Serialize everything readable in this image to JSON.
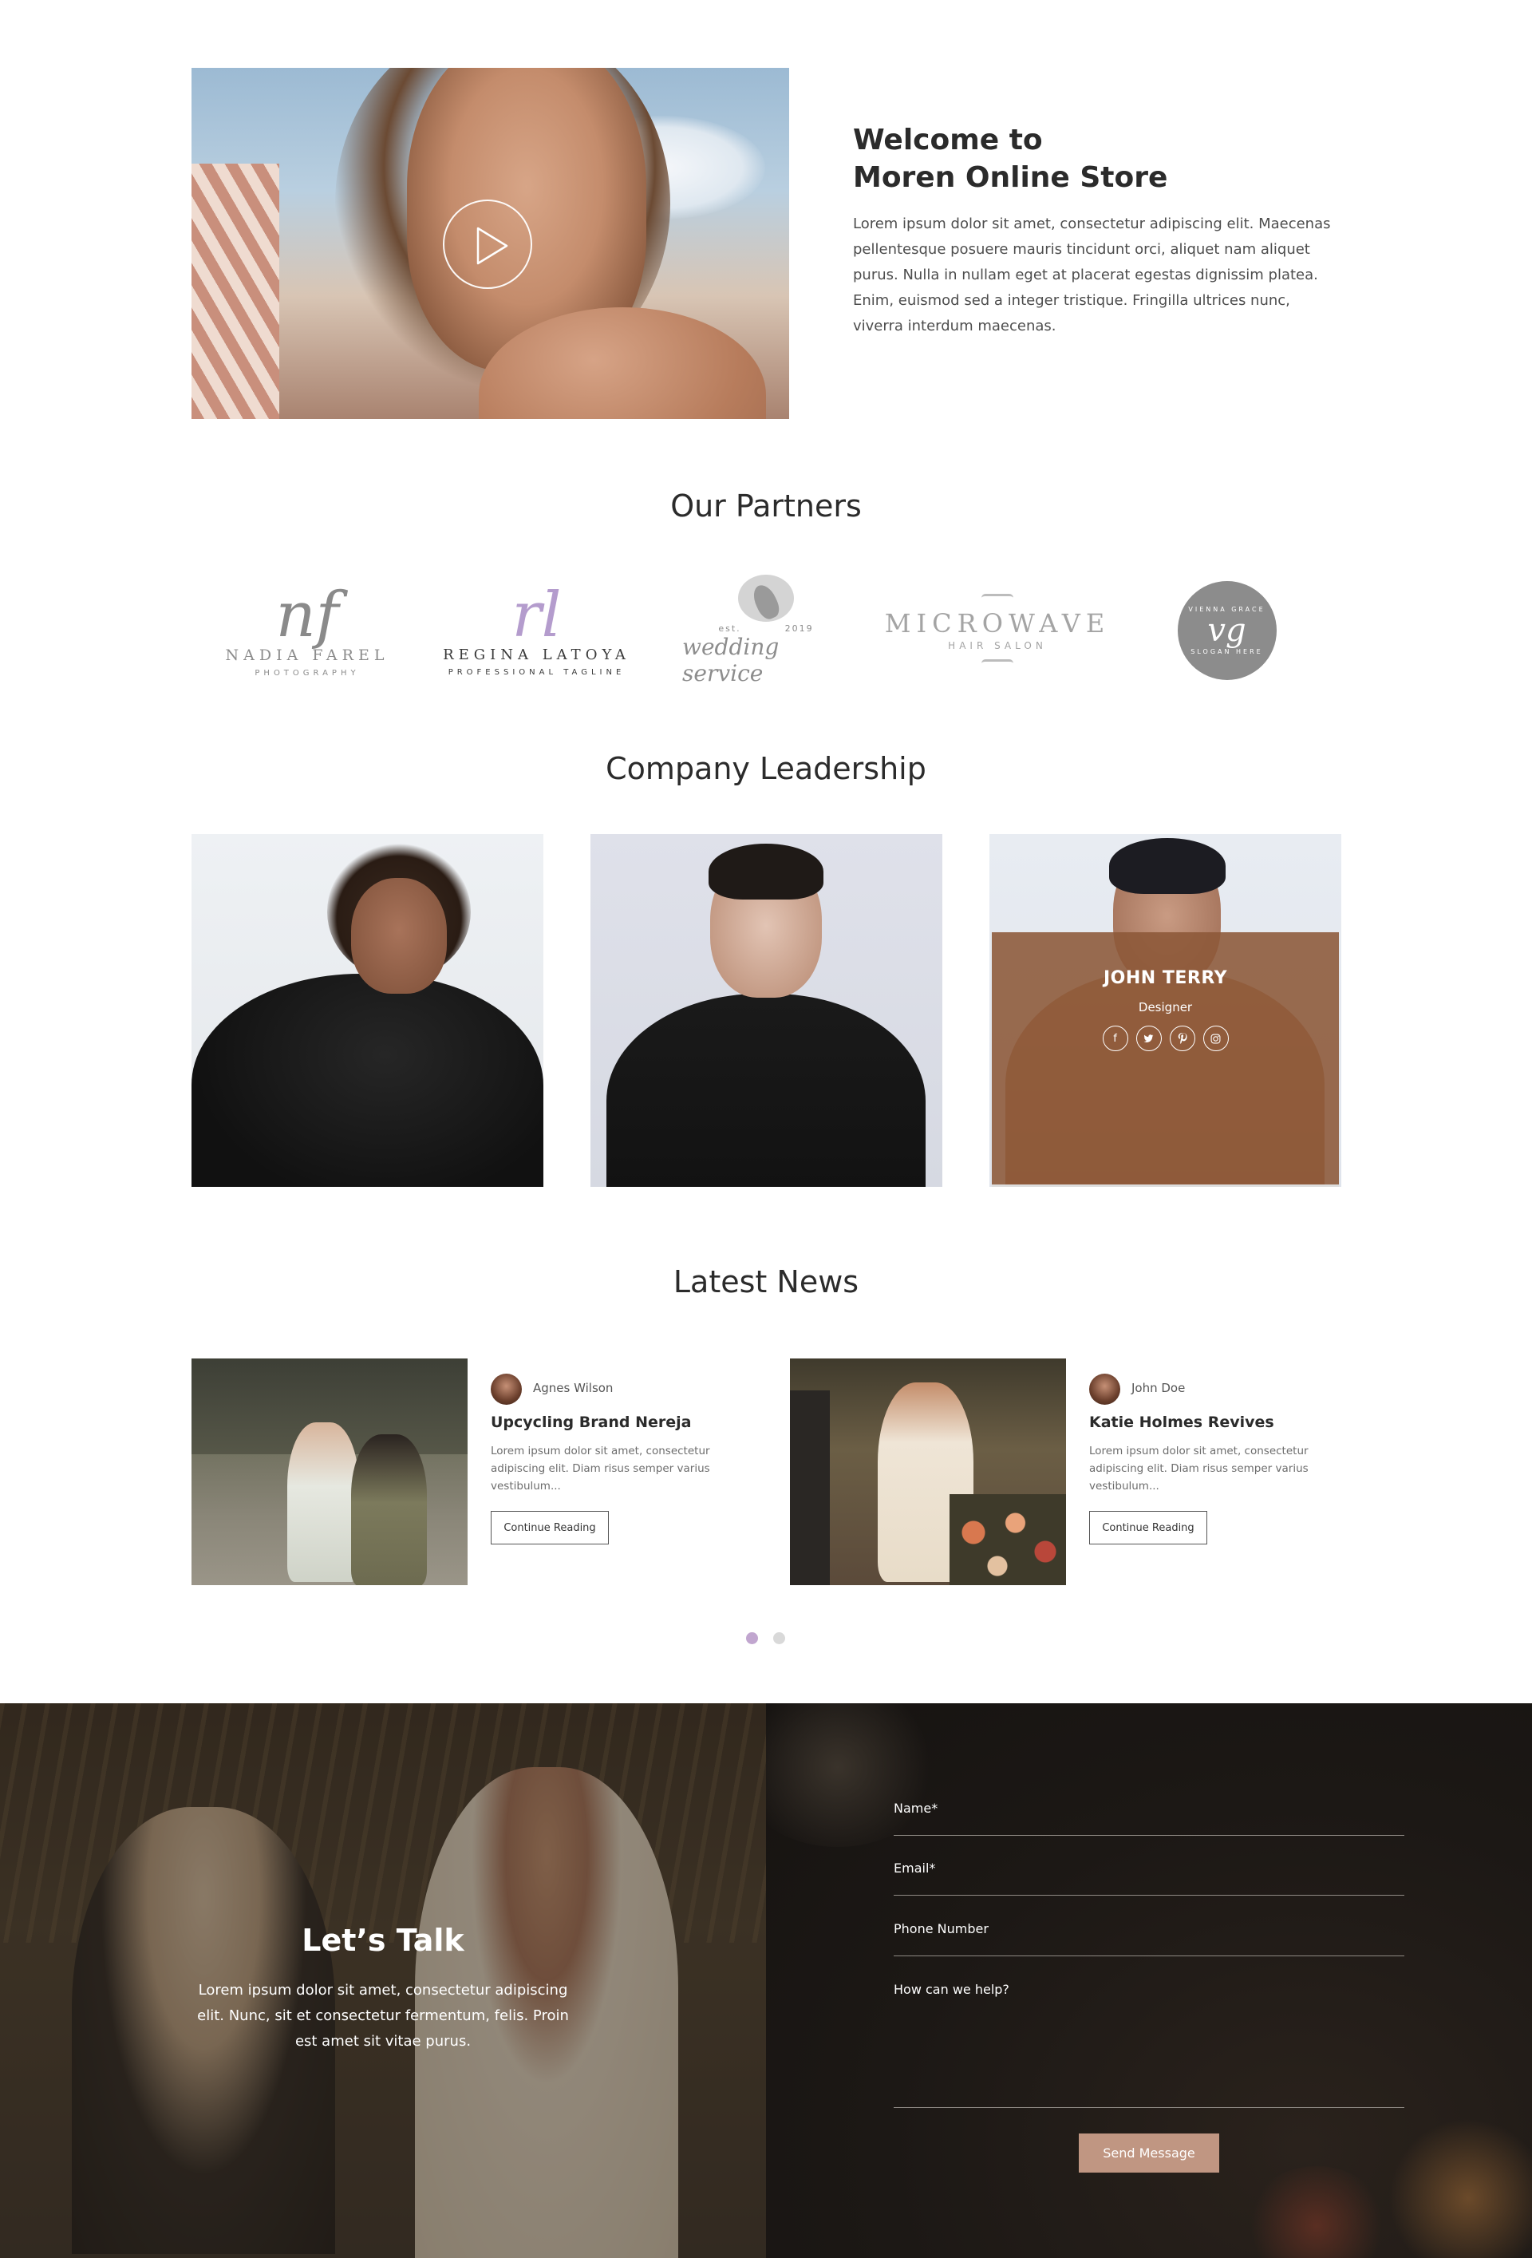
{
  "welcome": {
    "title_line1": "Welcome to",
    "title_line2": "Moren Online Store",
    "body": "Lorem ipsum dolor sit amet, consectetur adipiscing elit. Maecenas pellentesque posuere mauris tincidunt orci, aliquet nam aliquet purus. Nulla in nullam eget at placerat egestas dignissim platea. Enim, euismod sed a integer tristique. Fringilla ultrices nunc, viverra interdum maecenas."
  },
  "partners": {
    "title": "Our Partners",
    "logos": [
      {
        "mark": "nf",
        "name": "NADIA FAREL",
        "tagline": "PHOTOGRAPHY"
      },
      {
        "mark": "rl",
        "name": "REGINA LATOYA",
        "tagline": "PROFESSIONAL TAGLINE"
      },
      {
        "est": "est.",
        "year": "2019",
        "name": "wedding service"
      },
      {
        "name": "MICROWAVE",
        "tagline": "HAIR SALON"
      },
      {
        "top": "VIENNA GRACE",
        "mark": "vg",
        "bottom": "SLOGAN HERE"
      }
    ]
  },
  "leadership": {
    "title": "Company Leadership",
    "featured": {
      "name": "JOHN TERRY",
      "role": "Designer"
    },
    "social_icons": [
      "facebook-icon",
      "twitter-icon",
      "pinterest-icon",
      "instagram-icon"
    ]
  },
  "news": {
    "title": "Latest News",
    "posts": [
      {
        "author": "Agnes Wilson",
        "title": "Upcycling Brand Nereja",
        "excerpt": "Lorem ipsum dolor sit amet, consectetur adipiscing elit. Diam risus semper varius vestibulum...",
        "button": "Continue Reading"
      },
      {
        "author": "John Doe",
        "title": "Katie Holmes Revives",
        "excerpt": "Lorem ipsum dolor sit amet, consectetur adipiscing elit. Diam risus semper varius vestibulum...",
        "button": "Continue Reading"
      }
    ],
    "active_slide": 1,
    "slide_count": 2
  },
  "contact": {
    "title": "Let’s Talk",
    "body": "Lorem ipsum dolor sit amet, consectetur adipiscing elit. Nunc, sit et consectetur fermentum, felis. Proin est amet sit vitae purus.",
    "fields": {
      "name": "Name*",
      "email": "Email*",
      "phone": "Phone Number",
      "message": "How can we help?"
    },
    "submit": "Send Message"
  },
  "colors": {
    "accent": "#c09682",
    "overlay": "#8c5838",
    "dot_active": "#c1a6cf",
    "heading": "#2b2b2b"
  }
}
